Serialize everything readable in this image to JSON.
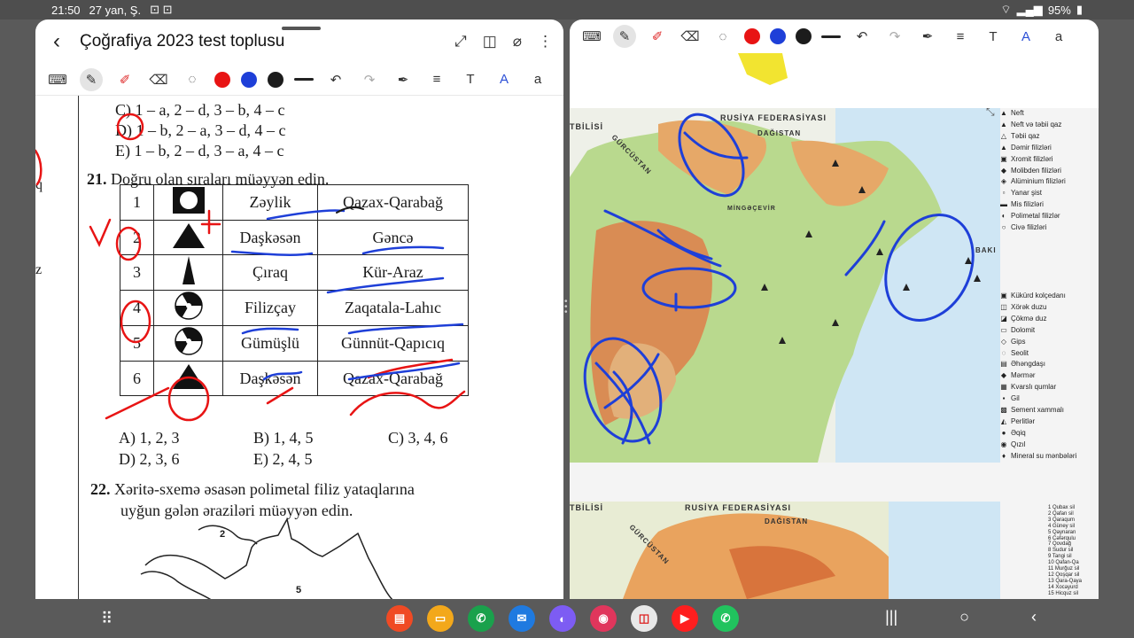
{
  "status": {
    "time": "21:50",
    "date": "27 yan, Ş.",
    "battery": "95%"
  },
  "left": {
    "title": "Çoğrafiya 2023 test toplusu",
    "colors": {
      "red": "#e81414",
      "blue": "#1e3fd8",
      "black": "#1c1c1c"
    },
    "options_prev": [
      "C) 1 – a, 2 – d, 3 – b, 4 – c",
      "D) 1 – b, 2 – a, 3 – d, 4 – c",
      "E) 1 – b, 2 – d, 3 – a, 4 – c"
    ],
    "side_letters": [
      "q",
      "z"
    ],
    "q21": {
      "num": "21.",
      "text": "Doğru olan sıraları müəyyən edin."
    },
    "table": [
      {
        "n": "1",
        "symbol": "iron-ore-icon",
        "place": "Zəylik",
        "region": "Qazax-Qarabağ"
      },
      {
        "n": "2",
        "symbol": "triangle-icon",
        "place": "Daşkəsən",
        "region": "Gəncə"
      },
      {
        "n": "3",
        "symbol": "narrow-triangle-icon",
        "place": "Çıraq",
        "region": "Kür-Araz"
      },
      {
        "n": "4",
        "symbol": "radiation-icon",
        "place": "Filizçay",
        "region": "Zaqatala-Lahıc"
      },
      {
        "n": "5",
        "symbol": "radiation-icon",
        "place": "Gümüşlü",
        "region": "Günnüt-Qapıcıq"
      },
      {
        "n": "6",
        "symbol": "triangle-icon",
        "place": "Daşkəsən",
        "region": "Qazax-Qarabağ"
      }
    ],
    "answers_row1": [
      "A) 1, 2, 3",
      "B) 1, 4, 5",
      "C) 3, 4, 6"
    ],
    "answers_row2": [
      "D) 2, 3, 6",
      "E) 2, 4, 5"
    ],
    "q22": {
      "num": "22.",
      "line1": "Xəritə-sxemə əsasən polimetal filiz yataqlarına",
      "line2": "uyğun gələn əraziləri müəyyən edin."
    },
    "sketch_labels": [
      "2",
      "5"
    ]
  },
  "right": {
    "map_labels": {
      "russia": "RUSİYA FEDERASİYASI",
      "dagestan": "DAĞISTAN",
      "tbilisi": "TBİLİSİ",
      "georgia": "GÜRCÜSTAN",
      "baku": "BAKI",
      "mingecevir": "MİNGƏÇEVİR",
      "russia2": "RUSİYA FEDERASİYASI",
      "dagestan2": "DAĞISTAN",
      "tbilisi2": "TBİLİSİ",
      "georgia2": "GÜRCÜSTAN"
    },
    "legend1": [
      "Neft",
      "Neft və təbii qaz",
      "Təbii qaz",
      "Dəmir filizləri",
      "Xromit filizləri",
      "Molibden filizləri",
      "Alüminium filizləri",
      "Yanar şist",
      "Mis filizləri",
      "Polimetal filizlər",
      "Civə filizləri"
    ],
    "legend2": [
      "Kükürd kolçedanı",
      "Xörək duzu",
      "Çökmə duz",
      "Dolomit",
      "Gips",
      "Seolit",
      "Əhəngdaşı",
      "Mərmər",
      "Kvarslı qumlar",
      "Gil",
      "Sement xammalı",
      "Perlitlər",
      "Əqiq",
      "Qızıl",
      "Mineral su mənbələri"
    ],
    "legend3": [
      "1  Qubax sil",
      "2  Qafan sil",
      "3  Qaraqum",
      "4  Güney sil",
      "5  Qaynaran",
      "6  Cəfərqulu",
      "7  Qovdağ",
      "8  Sudur sil",
      "9  Tangi sil",
      "10  Qafan-Qa",
      "11  Murğuz sil",
      "12  Qoşqar sil",
      "13  Qara-Qaya",
      "14  Xocayurd",
      "15  Hicquz sil"
    ]
  }
}
